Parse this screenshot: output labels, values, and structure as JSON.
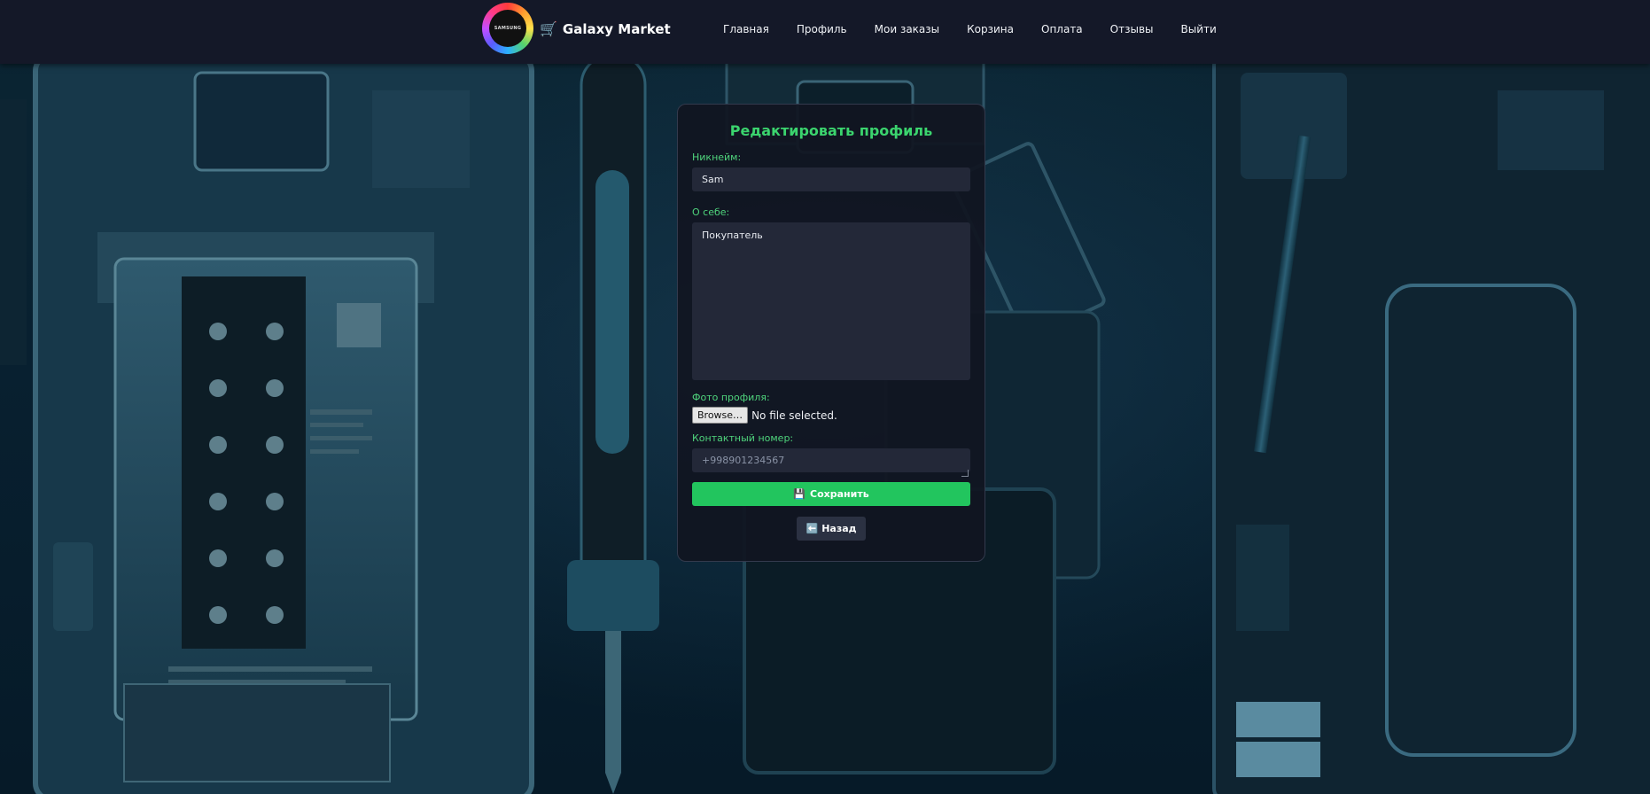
{
  "header": {
    "logo_text": "SAMSUNG",
    "brand_icon": "🛒",
    "brand_name": "Galaxy Market",
    "nav": [
      {
        "label": "Главная"
      },
      {
        "label": "Профиль"
      },
      {
        "label": "Мои заказы"
      },
      {
        "label": "Корзина"
      },
      {
        "label": "Оплата"
      },
      {
        "label": "Отзывы"
      },
      {
        "label": "Выйти"
      }
    ]
  },
  "form": {
    "title": "Редактировать профиль",
    "nickname_label": "Никнейм:",
    "nickname_value": "Sam",
    "about_label": "О себе:",
    "about_value": "Покупатель",
    "photo_label": "Фото профиля:",
    "browse_label": "Browse…",
    "file_status": "No file selected.",
    "phone_label": "Контактный номер:",
    "phone_placeholder": "+998901234567",
    "save_icon": "💾",
    "save_label": "Сохранить",
    "back_icon": "⬅️",
    "back_label": "Назад"
  },
  "colors": {
    "accent_green": "#22c55e",
    "title_green": "#3bd46e",
    "header_bg": "#141828",
    "card_bg": "#111521"
  }
}
